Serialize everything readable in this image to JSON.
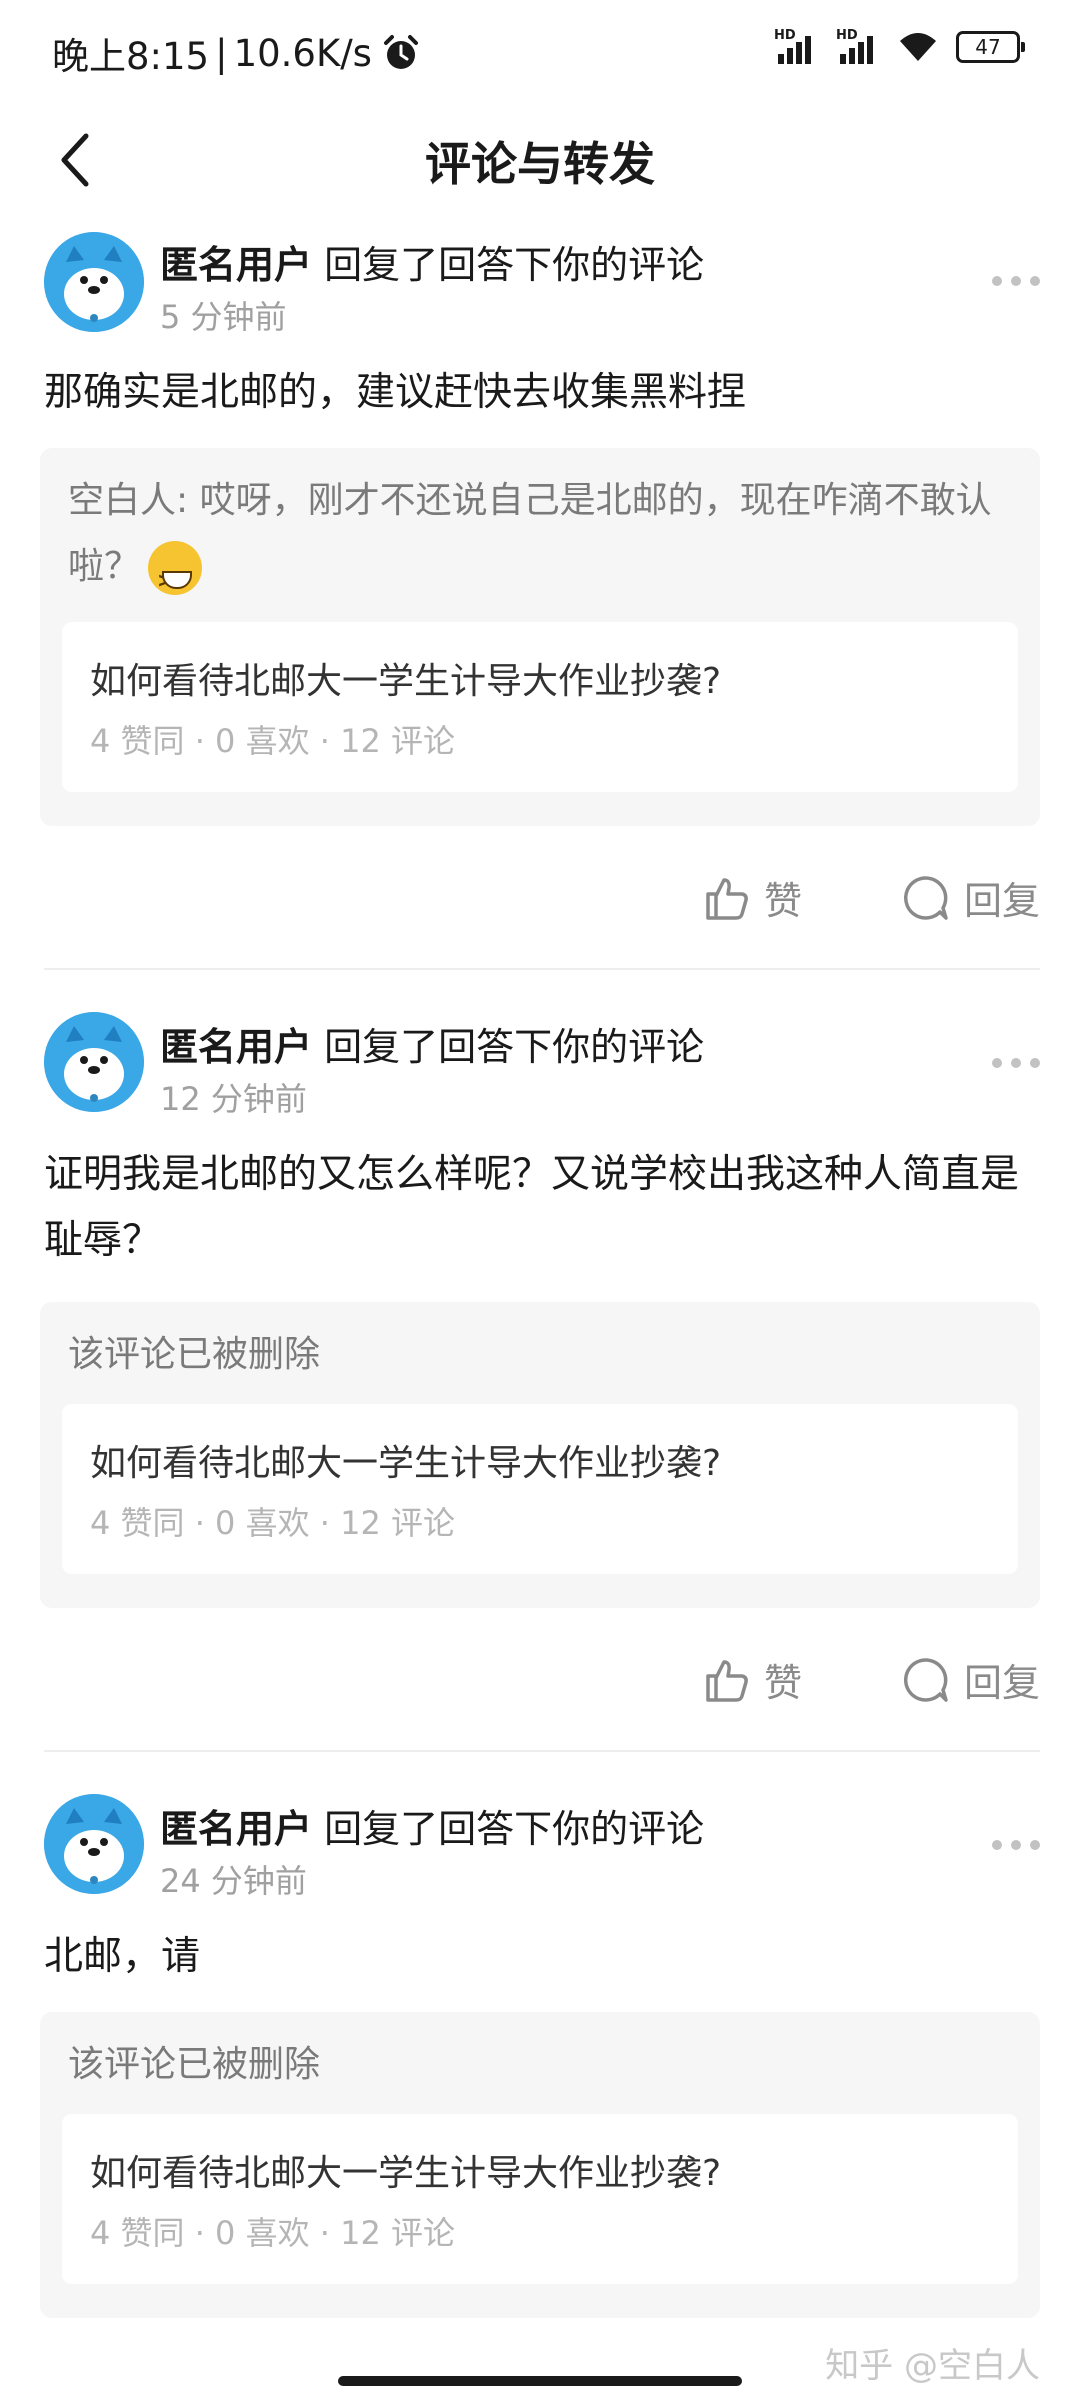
{
  "status_bar": {
    "time": "晚上8:15",
    "separator": "|",
    "speed": "10.6K/s",
    "signal_label_1": "HD",
    "signal_label_2": "HD",
    "battery": "47",
    "icons": [
      "alarm-icon",
      "signal-icon",
      "signal-icon",
      "wifi-icon",
      "battery-icon"
    ]
  },
  "header": {
    "title": "评论与转发",
    "back_icon": "chevron-left-icon"
  },
  "items": [
    {
      "user": "匿名用户",
      "action": "回复了回答下你的评论",
      "time": "5 分钟前",
      "content": "那确实是北邮的，建议赶快去收集黑料捏",
      "quote": "空白人: 哎呀，刚才不还说自己是北邮的，现在咋滴不敢认啦？",
      "quote_emoji": "laughing-emoji",
      "question": {
        "title": "如何看待北邮大一学生计导大作业抄袭?",
        "stats": "4 赞同 · 0 喜欢 · 12 评论"
      },
      "like_label": "赞",
      "reply_label": "回复"
    },
    {
      "user": "匿名用户",
      "action": "回复了回答下你的评论",
      "time": "12 分钟前",
      "content": "证明我是北邮的又怎么样呢？又说学校出我这种人简直是耻辱？",
      "quote": "该评论已被删除",
      "question": {
        "title": "如何看待北邮大一学生计导大作业抄袭?",
        "stats": "4 赞同 · 0 喜欢 · 12 评论"
      },
      "like_label": "赞",
      "reply_label": "回复"
    },
    {
      "user": "匿名用户",
      "action": "回复了回答下你的评论",
      "time": "24 分钟前",
      "content": "北邮，请",
      "quote": "该评论已被删除",
      "question": {
        "title": "如何看待北邮大一学生计导大作业抄袭?",
        "stats": "4 赞同 · 0 喜欢 · 12 评论"
      }
    }
  ],
  "watermark": "知乎 @空白人"
}
